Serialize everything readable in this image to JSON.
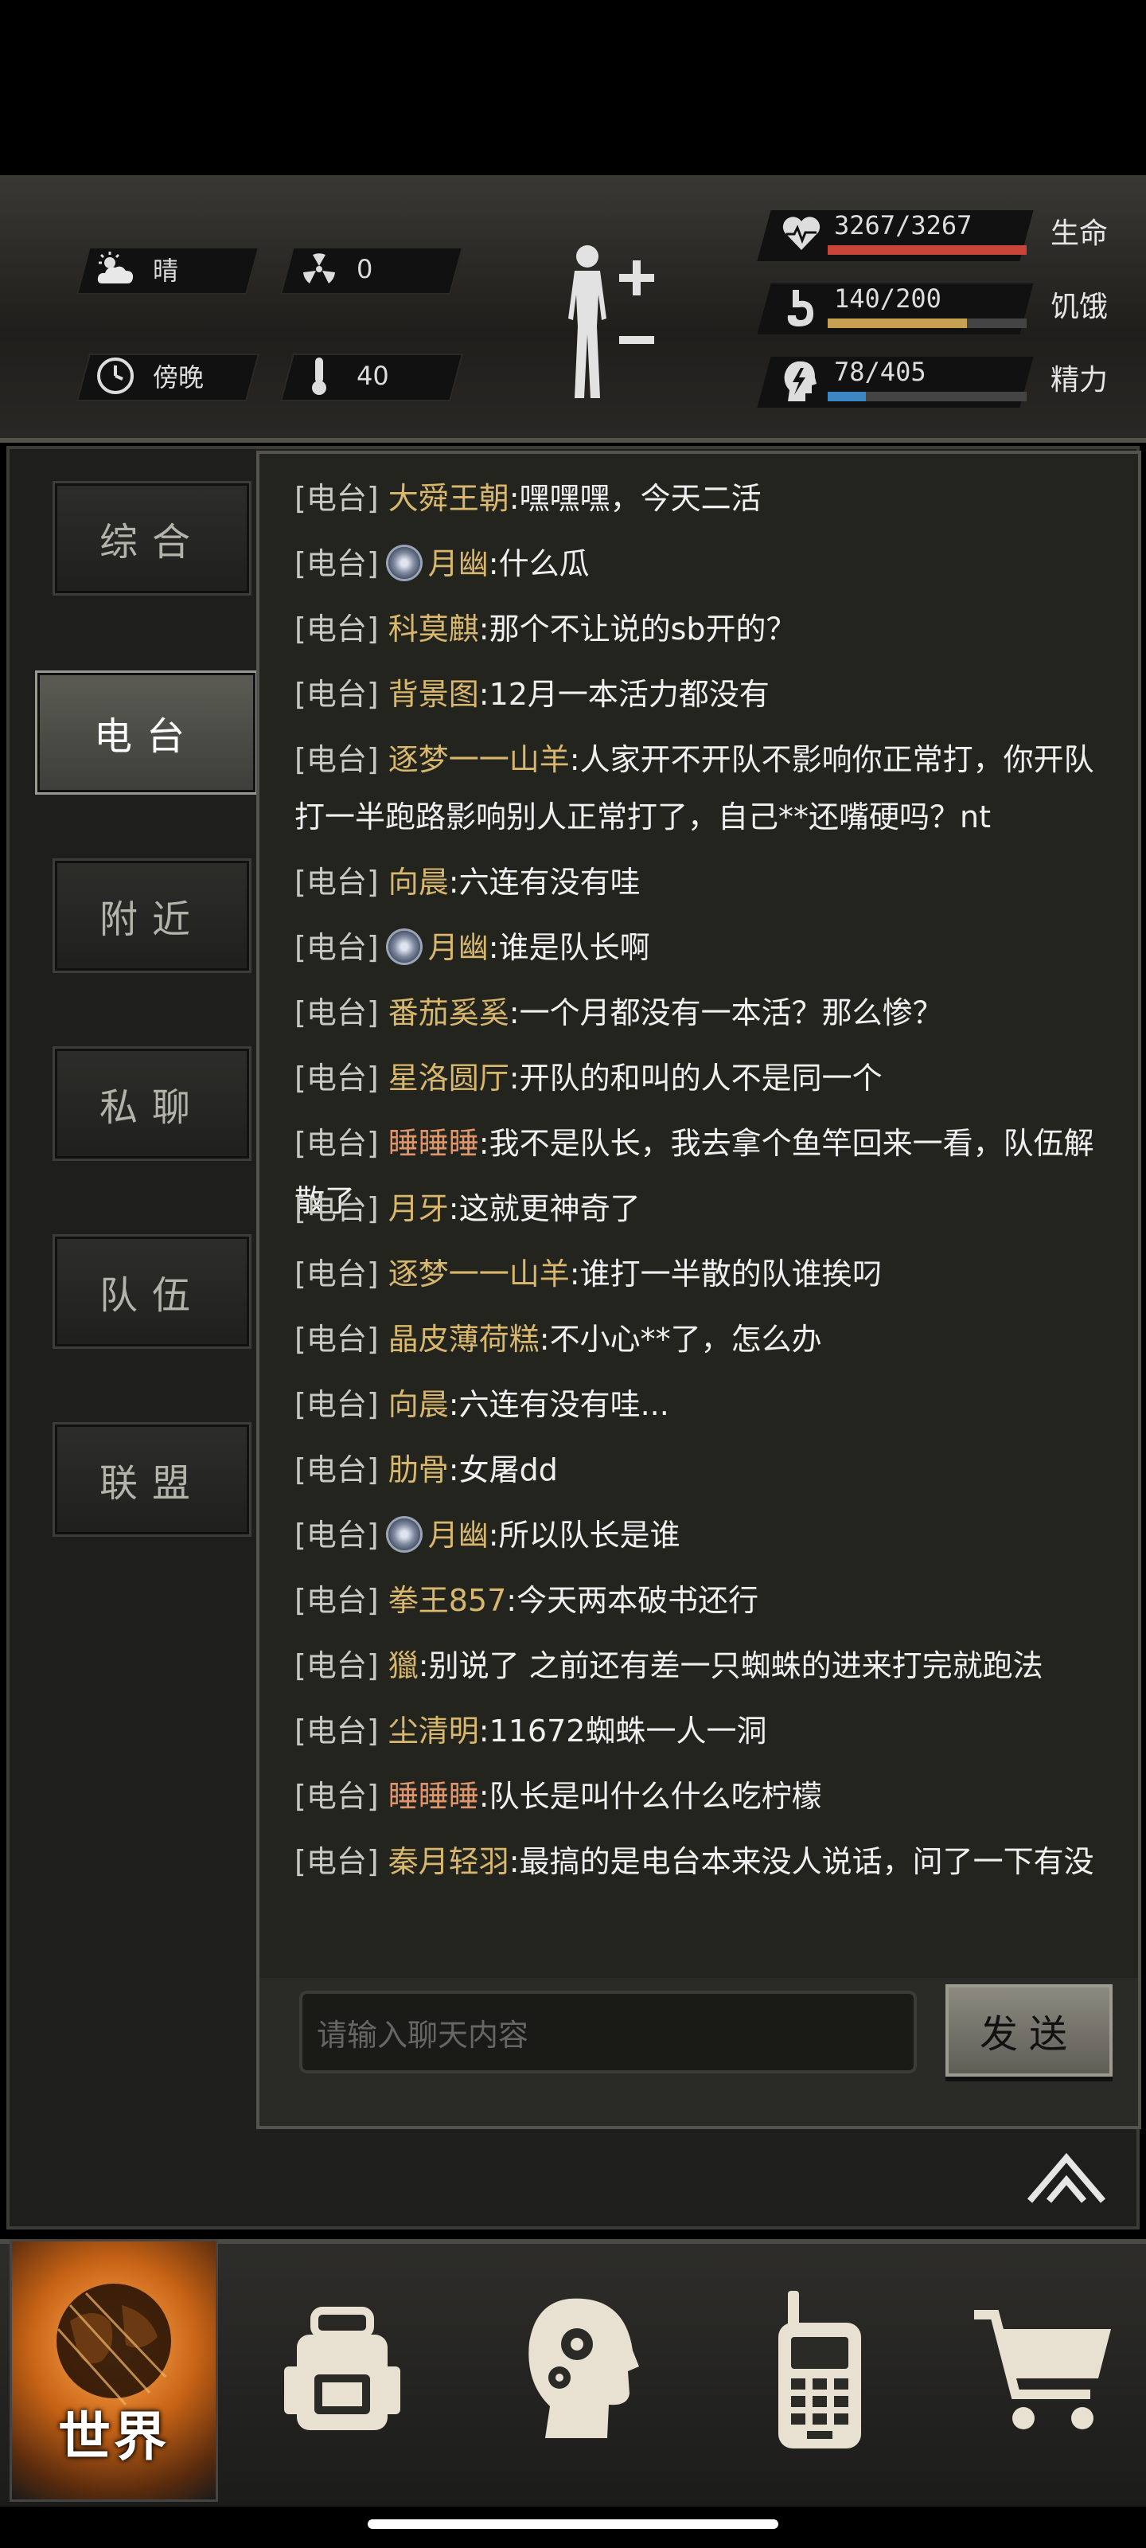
{
  "status": {
    "weather": {
      "label": "晴",
      "icon": "sunny-cloud-icon"
    },
    "radiation": {
      "value": "0",
      "icon": "radiation-icon"
    },
    "time": {
      "label": "傍晚",
      "icon": "clock-icon"
    },
    "temperature": {
      "value": "40",
      "icon": "thermometer-icon"
    },
    "body_icon": "body-silhouette-icon",
    "health": {
      "value": "3267/3267",
      "label": "生命",
      "fill": 1.0,
      "color": "#c9453a",
      "icon": "heart-pulse-icon"
    },
    "hunger": {
      "value": "140/200",
      "label": "饥饿",
      "fill": 0.7,
      "color": "#c7a051",
      "icon": "stomach-icon"
    },
    "energy": {
      "value": "78/405",
      "label": "精力",
      "fill": 0.19,
      "color": "#3d86c6",
      "icon": "head-lightning-icon"
    }
  },
  "tabs": [
    {
      "label": "综合"
    },
    {
      "label": "电台"
    },
    {
      "label": "附近"
    },
    {
      "label": "私聊"
    },
    {
      "label": "队伍"
    },
    {
      "label": "联盟"
    }
  ],
  "active_tab": "电台",
  "messages": [
    {
      "channel": "[电台]",
      "name": "大舜王朝",
      "text": ":嘿嘿嘿，今天二活"
    },
    {
      "channel": "[电台]",
      "name": "月幽",
      "badge": true,
      "text": ":什么瓜"
    },
    {
      "channel": "[电台]",
      "name": "科莫麒",
      "text": ":那个不让说的sb开的？"
    },
    {
      "channel": "[电台]",
      "name": "背景图",
      "text": ":12月一本活力都没有"
    },
    {
      "channel": "[电台]",
      "name": "逐梦一一山羊",
      "text": ":人家开不开队不影响你正常打，你开队打一半跑路影响别人正常打了，自己**还嘴硬吗？nt"
    },
    {
      "channel": "[电台]",
      "name": "向晨",
      "text": ":六连有没有哇"
    },
    {
      "channel": "[电台]",
      "name": "月幽",
      "badge": true,
      "text": ":谁是队长啊"
    },
    {
      "channel": "[电台]",
      "name": "番茄奚奚",
      "text": ":一个月都没有一本活？那么惨？"
    },
    {
      "channel": "[电台]",
      "name": "星洛圆厅",
      "text": ":开队的和叫的人不是同一个"
    },
    {
      "channel": "[电台]",
      "name": "睡睡睡",
      "orange": true,
      "text": ":我不是队长，我去拿个鱼竿回来一看，队伍解散了"
    },
    {
      "channel": "[电台]",
      "name": "月牙",
      "text": ":这就更神奇了"
    },
    {
      "channel": "[电台]",
      "name": "逐梦一一山羊",
      "text": ":谁打一半散的队谁挨叼"
    },
    {
      "channel": "[电台]",
      "name": "晶皮薄荷糕",
      "text": ":不小心**了，怎么办"
    },
    {
      "channel": "[电台]",
      "name": "向晨",
      "text": ":六连有没有哇..."
    },
    {
      "channel": "[电台]",
      "name": "肋骨",
      "text": ":女屠dd"
    },
    {
      "channel": "[电台]",
      "name": "月幽",
      "badge": true,
      "text": ":所以队长是谁"
    },
    {
      "channel": "[电台]",
      "name": "拳王857",
      "text": ":今天两本破书还行"
    },
    {
      "channel": "[电台]",
      "name": "獵",
      "text": ":别说了 之前还有差一只蜘蛛的进来打完就跑法"
    },
    {
      "channel": "[电台]",
      "name": "尘清明",
      "text": ":11672蜘蛛一人一洞"
    },
    {
      "channel": "[电台]",
      "name": "睡睡睡",
      "orange": true,
      "text": ":队长是叫什么什么吃柠檬"
    },
    {
      "channel": "[电台]",
      "name": "秦月轻羽",
      "text": ":最搞的是电台本来没人说话，问了一下有没"
    }
  ],
  "input": {
    "placeholder": "请输入聊天内容"
  },
  "send_label": "发送",
  "scroll_up_icon": "double-chevron-up-icon",
  "nav": [
    {
      "label": "世界",
      "icon": "globe-icon",
      "active": true
    },
    {
      "label": "",
      "icon": "backpack-icon"
    },
    {
      "label": "",
      "icon": "head-gears-icon"
    },
    {
      "label": "",
      "icon": "walkie-talkie-icon"
    },
    {
      "label": "",
      "icon": "shopping-cart-icon"
    }
  ]
}
